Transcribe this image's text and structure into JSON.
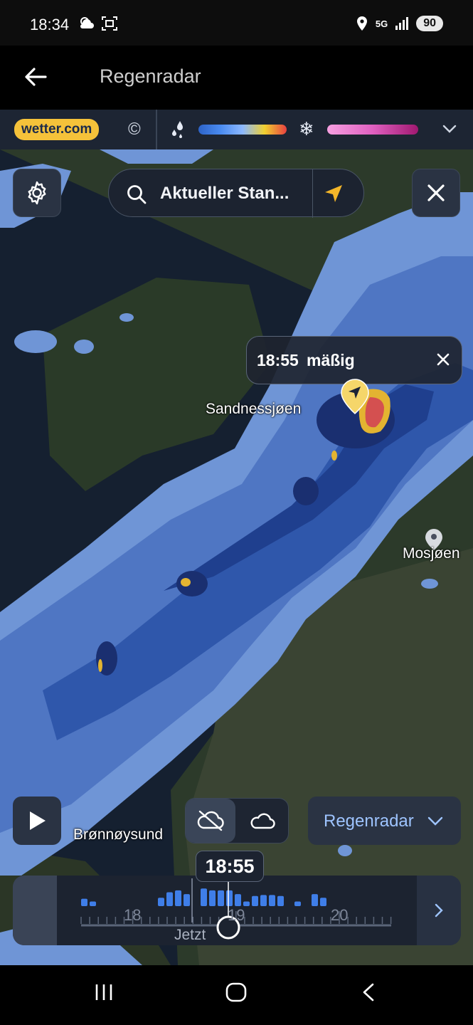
{
  "status": {
    "time": "18:34",
    "network": "5G",
    "battery": "90",
    "icons": [
      "weather-cloud-icon",
      "screenshot-icon",
      "location-icon",
      "signal-icon"
    ]
  },
  "app_bar": {
    "title": "Regenradar",
    "back_icon": "arrow-left-icon"
  },
  "legend": {
    "brand": "wetter.com",
    "copyright": "©",
    "rain_icon": "rain-drops-icon",
    "snow_icon": "❄",
    "colors": {
      "rain_low": "#2d63c8",
      "rain_high": "#e84040",
      "snow_low": "#f6a0e0",
      "snow_high": "#a01870"
    }
  },
  "search": {
    "text": "Aktueller Stan..."
  },
  "tooltip": {
    "time": "18:55",
    "text": "mäßig"
  },
  "map": {
    "labels": {
      "sandnessjoen": "Sandnessjøen",
      "mosjoen": "Mosjøen",
      "bronnoysund": "Brønnøysund"
    }
  },
  "controls": {
    "layer": "Regenradar"
  },
  "timeline": {
    "current_time": "18:55",
    "ticks": [
      "18",
      "19",
      "20"
    ],
    "now_label": "Jetzt",
    "bars": [
      0.4,
      0.25,
      0,
      0,
      0,
      0,
      0,
      0,
      0,
      0.45,
      0.75,
      0.85,
      0.65,
      0,
      0.95,
      0.85,
      0.85,
      0.85,
      0.65,
      0.25,
      0.55,
      0.6,
      0.6,
      0.55,
      0,
      0.25,
      0,
      0.65,
      0.45
    ]
  }
}
